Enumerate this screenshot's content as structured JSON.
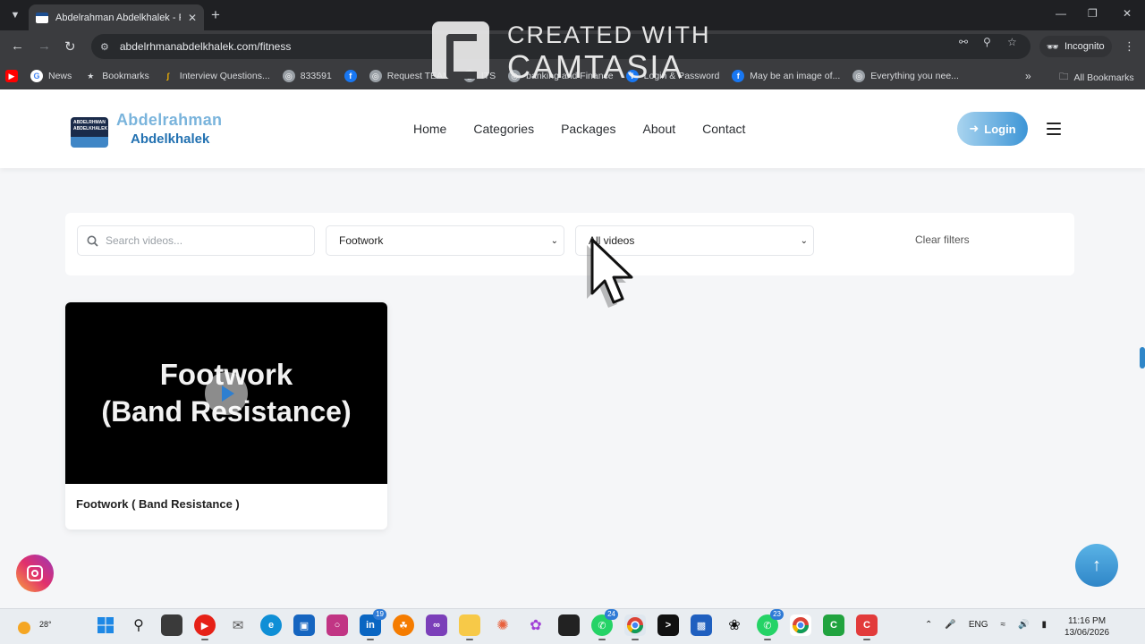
{
  "browser": {
    "tab_title": "Abdelrahman Abdelkhalek - Pe",
    "url": "abdelrhmanabdelkhalek.com/fitness",
    "incognito_label": "Incognito",
    "bookmarks": [
      {
        "label": "News",
        "icon": "google-icon",
        "color": "#ffffff"
      },
      {
        "label": "Bookmarks",
        "icon": "star-icon",
        "color": "#d8dadd"
      },
      {
        "label": "Interview Questions...",
        "icon": "chart-icon",
        "color": "#f4b400"
      },
      {
        "label": "833591",
        "icon": "globe-icon",
        "color": "#9aa0a6"
      },
      {
        "label": "",
        "icon": "facebook-icon",
        "color": "#1877f2"
      },
      {
        "label": "Request TEAM",
        "icon": "globe-icon",
        "color": "#9aa0a6"
      },
      {
        "label": "ITS",
        "icon": "globe-icon",
        "color": "#9aa0a6"
      },
      {
        "label": "banking and Finance",
        "icon": "globe-icon",
        "color": "#9aa0a6"
      },
      {
        "label": "Login & Password",
        "icon": "facebook-icon",
        "color": "#1877f2"
      },
      {
        "label": "May be an image of...",
        "icon": "facebook-icon",
        "color": "#1877f2"
      },
      {
        "label": "Everything you nee...",
        "icon": "globe-icon",
        "color": "#9aa0a6"
      }
    ],
    "all_bookmarks_label": "All Bookmarks"
  },
  "watermark": {
    "line1": "CREATED WITH",
    "line2": "CAMTASIA"
  },
  "site": {
    "brand_line1": "Abdelrahman",
    "brand_line2": "Abdelkhalek",
    "logo_text": "ABDELRHMAN ABDELKHALEK",
    "nav": [
      "Home",
      "Categories",
      "Packages",
      "About",
      "Contact"
    ],
    "login_label": "Login",
    "accent_color": "#2f86c8"
  },
  "filters": {
    "search_placeholder": "Search videos...",
    "category_selected": "Footwork",
    "type_selected": "All videos",
    "clear_label": "Clear filters"
  },
  "videos": [
    {
      "thumb_line1": "Footwork",
      "thumb_line2": "(Band Resistance)",
      "title": "Footwork ( Band Resistance )"
    }
  ],
  "taskbar": {
    "temperature": "28°",
    "language": "ENG",
    "time": "11:16 PM",
    "date": "13/06/2026",
    "badges": {
      "linkedin": "19",
      "whatsapp": "24",
      "whatsapp2": "23"
    }
  }
}
